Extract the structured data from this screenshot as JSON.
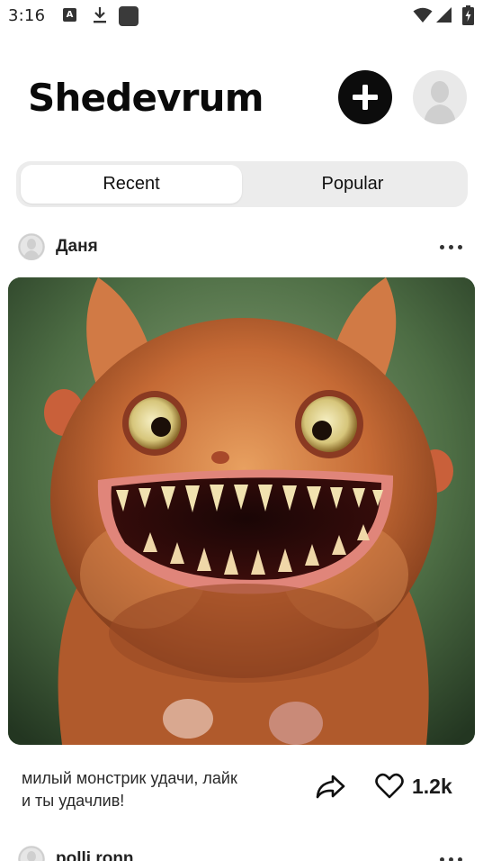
{
  "status_bar": {
    "time": "3:16",
    "notification_icons": [
      "text-badge-icon",
      "download-icon",
      "app-square-icon"
    ],
    "system_icons": [
      "wifi-icon",
      "signal-icon",
      "battery-charging-icon"
    ],
    "a_badge": "A"
  },
  "header": {
    "title": "Shedevrum",
    "add_icon": "plus-icon",
    "profile_icon": "user-avatar-icon"
  },
  "tabs": [
    {
      "label": "Recent",
      "selected": true
    },
    {
      "label": "Popular",
      "selected": false
    }
  ],
  "feed": {
    "posts": [
      {
        "author": "Даня",
        "image_subject": "monster-image",
        "caption_lines": [
          "милый монстрик удачи, лайк",
          "и ты удачлив!"
        ],
        "likes": "1.2k"
      },
      {
        "author": "polli.ronn"
      }
    ]
  },
  "colors": {
    "accent": "#0c0c0c",
    "tab_track": "#ececec",
    "tab_active": "#ffffff"
  }
}
